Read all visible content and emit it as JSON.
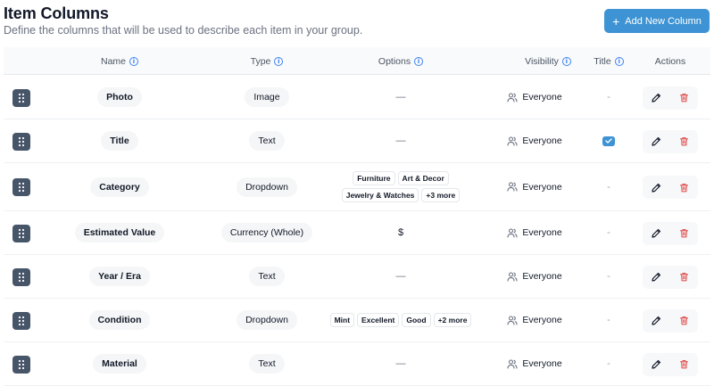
{
  "header": {
    "title": "Item Columns",
    "subtitle": "Define the columns that will be used to describe each item in your group.",
    "add_button_label": "Add New Column"
  },
  "columns": {
    "name": "Name",
    "type": "Type",
    "options": "Options",
    "visibility": "Visibility",
    "title": "Title",
    "actions": "Actions"
  },
  "rows": [
    {
      "name": "Photo",
      "type": "Image",
      "options_text": "—",
      "tags": [],
      "visibility": "Everyone",
      "is_title": false,
      "title_text": "-"
    },
    {
      "name": "Title",
      "type": "Text",
      "options_text": "—",
      "tags": [],
      "visibility": "Everyone",
      "is_title": true,
      "title_text": ""
    },
    {
      "name": "Category",
      "type": "Dropdown",
      "options_text": "",
      "tags": [
        "Furniture",
        "Art & Decor",
        "Jewelry & Watches",
        "+3 more"
      ],
      "visibility": "Everyone",
      "is_title": false,
      "title_text": "-"
    },
    {
      "name": "Estimated Value",
      "type": "Currency (Whole)",
      "options_text": "$",
      "tags": [],
      "visibility": "Everyone",
      "is_title": false,
      "title_text": "-"
    },
    {
      "name": "Year / Era",
      "type": "Text",
      "options_text": "—",
      "tags": [],
      "visibility": "Everyone",
      "is_title": false,
      "title_text": "-"
    },
    {
      "name": "Condition",
      "type": "Dropdown",
      "options_text": "",
      "tags": [
        "Mint",
        "Excellent",
        "Good",
        "+2 more"
      ],
      "visibility": "Everyone",
      "is_title": false,
      "title_text": "-"
    },
    {
      "name": "Material",
      "type": "Text",
      "options_text": "—",
      "tags": [],
      "visibility": "Everyone",
      "is_title": false,
      "title_text": "-"
    }
  ],
  "colors": {
    "accent": "#3d93d3",
    "drag_handle": "#475569",
    "delete": "#e05555",
    "info": "#3b82f6"
  },
  "icons": {
    "drag": "grip-dots-icon",
    "edit": "pencil-icon",
    "delete": "trash-icon",
    "visibility": "users-icon",
    "info": "info-circle-icon",
    "add": "plus-icon",
    "check": "checkmark-icon"
  }
}
